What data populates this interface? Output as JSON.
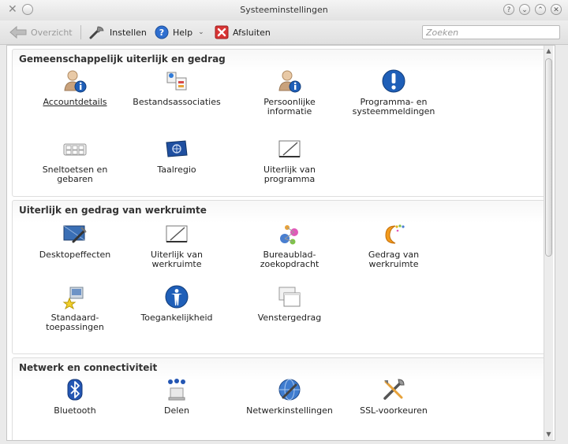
{
  "window": {
    "title": "Systeeminstellingen"
  },
  "toolbar": {
    "overview": "Overzicht",
    "configure": "Instellen",
    "help": "Help",
    "quit": "Afsluiten",
    "search_placeholder": "Zoeken"
  },
  "sections": [
    {
      "title": "Gemeenschappelijk uiterlijk en gedrag",
      "items": [
        {
          "label": "Accountdetails",
          "icon": "user-info-icon"
        },
        {
          "label": "Bestandsassociaties",
          "icon": "file-associations-icon"
        },
        {
          "label": "Persoonlijke\ninformatie",
          "icon": "personal-info-icon"
        },
        {
          "label": "Programma- en\nsysteemmeldingen",
          "icon": "notifications-icon"
        },
        {
          "label": "Sneltoetsen en\ngebaren",
          "icon": "keyboard-shortcuts-icon"
        },
        {
          "label": "Taalregio",
          "icon": "locale-flag-icon"
        },
        {
          "label": "Uiterlijk van\nprogramma",
          "icon": "application-appearance-icon"
        }
      ]
    },
    {
      "title": "Uiterlijk en gedrag van werkruimte",
      "items": [
        {
          "label": "Desktopeffecten",
          "icon": "desktop-effects-icon"
        },
        {
          "label": "Uiterlijk van\nwerkruimte",
          "icon": "workspace-appearance-icon"
        },
        {
          "label": "Bureaublad-\nzoekopdracht",
          "icon": "desktop-search-icon"
        },
        {
          "label": "Gedrag van\nwerkruimte",
          "icon": "workspace-behavior-icon"
        },
        {
          "label": "Standaard-\ntoepassingen",
          "icon": "default-applications-icon"
        },
        {
          "label": "Toegankelijkheid",
          "icon": "accessibility-icon"
        },
        {
          "label": "Venstergedrag",
          "icon": "window-behavior-icon"
        }
      ]
    },
    {
      "title": "Netwerk en connectiviteit",
      "items": [
        {
          "label": "Bluetooth",
          "icon": "bluetooth-icon"
        },
        {
          "label": "Delen",
          "icon": "sharing-icon"
        },
        {
          "label": "Netwerkinstellingen",
          "icon": "network-settings-icon"
        },
        {
          "label": "SSL-voorkeuren",
          "icon": "ssl-preferences-icon"
        }
      ]
    }
  ],
  "colors": {
    "accent_blue": "#1f5fb8",
    "window_bg": "#eaeaea",
    "panel_bg": "#ffffff"
  }
}
